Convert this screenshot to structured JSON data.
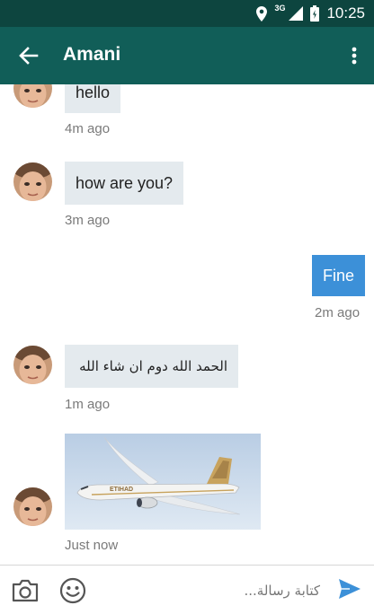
{
  "status_bar": {
    "time": "10:25",
    "network": "3G"
  },
  "header": {
    "title": "Amani"
  },
  "messages": [
    {
      "text": "hello",
      "time": "4m ago"
    },
    {
      "text": "how are you?",
      "time": "3m ago"
    },
    {
      "text": "Fine",
      "time": "2m ago"
    },
    {
      "text": "الحمد الله دوم ان شاء الله",
      "time": "1m ago"
    },
    {
      "image_caption": "ETIHAD",
      "time": "Just now"
    }
  ],
  "composer": {
    "placeholder": "كتابة رسالة..."
  },
  "colors": {
    "status_bar": "#0d453f",
    "app_bar": "#115e58",
    "incoming_bubble": "#e4eaee",
    "outgoing_bubble": "#3c90d8",
    "send_icon": "#3c90d8"
  }
}
